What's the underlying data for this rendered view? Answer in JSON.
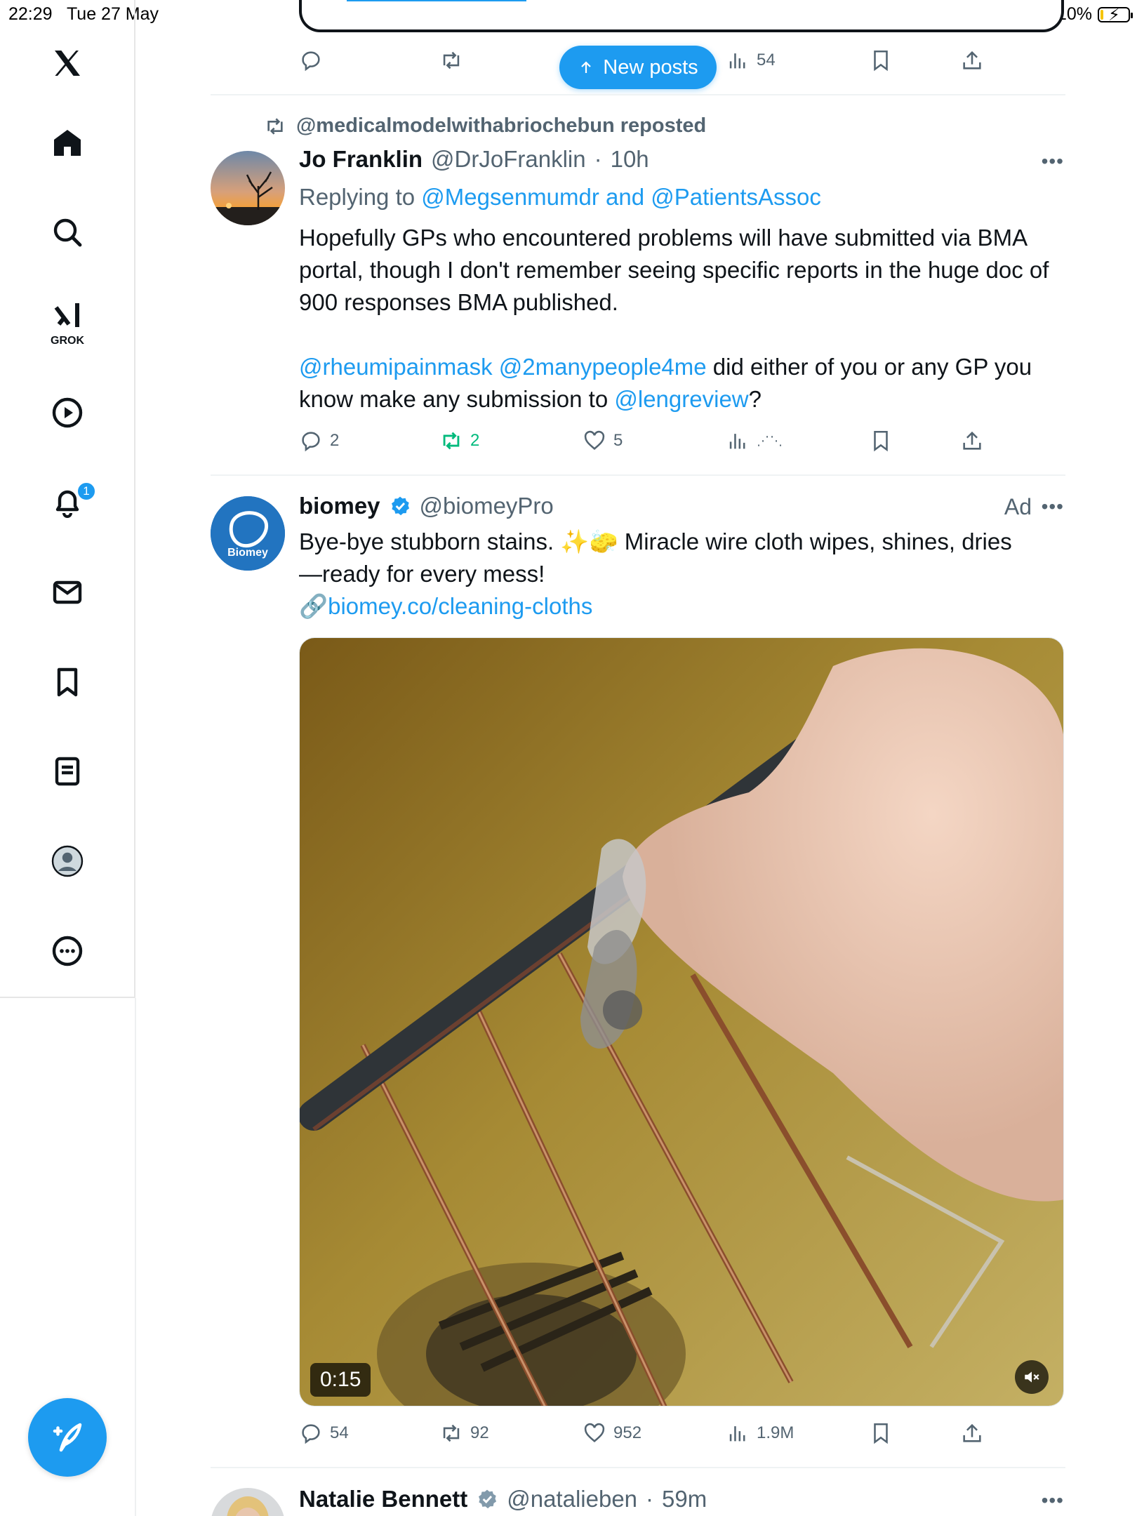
{
  "status_bar": {
    "time": "22:29",
    "date": "Tue 27 May",
    "battery": "10%",
    "battery_level": 0.1
  },
  "sidebar": {
    "logo": "x-logo-icon",
    "items": [
      {
        "name": "home",
        "icon": "home-icon"
      },
      {
        "name": "search",
        "icon": "search-icon"
      },
      {
        "name": "grok",
        "icon": "grok-icon",
        "label": "GROK"
      },
      {
        "name": "video",
        "icon": "play-icon"
      },
      {
        "name": "notifications",
        "icon": "bell-icon",
        "badge": "1"
      },
      {
        "name": "messages",
        "icon": "envelope-icon"
      },
      {
        "name": "bookmarks",
        "icon": "bookmark-icon"
      },
      {
        "name": "lists",
        "icon": "list-icon"
      },
      {
        "name": "profile",
        "icon": "profile-icon"
      },
      {
        "name": "more",
        "icon": "more-circle-icon"
      }
    ],
    "compose": "compose-icon"
  },
  "new_posts_label": "New posts",
  "tweet_top": {
    "actions": {
      "views": "54"
    }
  },
  "tweet1": {
    "reposted_by": "@medicalmodelwithabriochebun reposted",
    "name": "Jo Franklin",
    "handle": "@DrJoFranklin",
    "time": "10h",
    "replying_prefix": "Replying to",
    "replying_to": "@Megsenmumdr and @PatientsAssoc",
    "text_p1": "Hopefully GPs who encountered problems will have submitted via BMA portal, though I don't remember seeing specific reports in the huge doc of 900 responses BMA published.",
    "mention1": "@rheumipainmask",
    "mention2": "@2manypeople4me",
    "text_p2_mid": "did either of you or any GP you know make any submission to",
    "mention3": "@lengreview",
    "text_p2_end": "?",
    "replies": "2",
    "reposts": "2",
    "likes": "5"
  },
  "tweet2": {
    "name": "biomey",
    "handle": "@biomeyPro",
    "ad_label": "Ad",
    "avatar_text": "Biomey",
    "text_line1": "Bye-bye stubborn stains. ✨🧽 Miracle wire cloth wipes, shines, dries",
    "text_line2": "—ready for every mess!",
    "link_prefix": "🔗",
    "link": "biomey.co/cleaning-cloths",
    "video_time": "0:15",
    "replies": "54",
    "reposts": "92",
    "likes": "952",
    "views": "1.9M"
  },
  "tweet3": {
    "name": "Natalie Bennett",
    "handle": "@natalieben",
    "time": "59m"
  }
}
